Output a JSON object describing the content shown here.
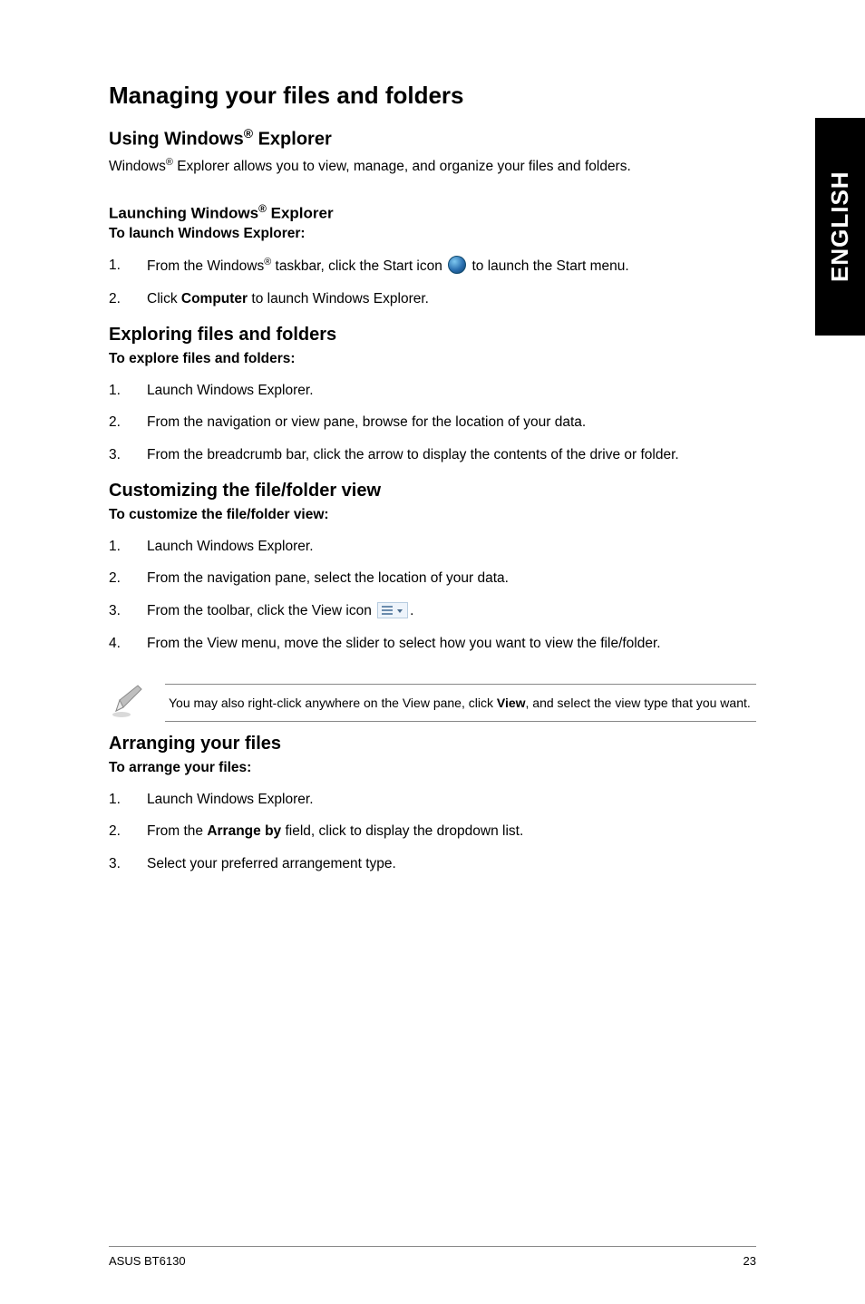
{
  "side_tab": "ENGLISH",
  "title": "Managing your files and folders",
  "s1": {
    "heading_pre": "Using Windows",
    "heading_sup": "®",
    "heading_post": " Explorer",
    "body_pre": "Windows",
    "body_sup": "®",
    "body_post": " Explorer allows you to view, manage, and organize your files and folders."
  },
  "s1a": {
    "heading_pre": "Launching Windows",
    "heading_sup": "®",
    "heading_post": " Explorer",
    "label": "To launch Windows Explorer:",
    "items": [
      {
        "num": "1.",
        "pre": "From the Windows",
        "sup": "®",
        "mid": " taskbar, click the Start icon ",
        "post": " to launch the Start menu."
      },
      {
        "num": "2.",
        "pre": "Click ",
        "bold": "Computer",
        "post": " to launch Windows Explorer."
      }
    ]
  },
  "s2": {
    "heading": "Exploring files and folders",
    "label": "To explore files and folders:",
    "items": [
      {
        "num": "1.",
        "text": "Launch Windows Explorer."
      },
      {
        "num": "2.",
        "text": "From the navigation or view pane, browse for the location of your data."
      },
      {
        "num": "3.",
        "text": "From the breadcrumb bar, click the arrow to display the contents of the drive or folder."
      }
    ]
  },
  "s3": {
    "heading": "Customizing the file/folder view",
    "label": "To customize the file/folder view:",
    "items": [
      {
        "num": "1.",
        "text": "Launch Windows Explorer."
      },
      {
        "num": "2.",
        "text": "From the navigation pane, select the location of your data."
      },
      {
        "num": "3.",
        "pre": "From the toolbar, click the View icon ",
        "post": "."
      },
      {
        "num": "4.",
        "text": "From the View menu, move the slider to select how you want to view the file/folder."
      }
    ],
    "note_pre": "You may also right-click anywhere on the View pane, click ",
    "note_bold": "View",
    "note_post": ", and select the view type that you want."
  },
  "s4": {
    "heading": "Arranging your files",
    "label": "To arrange your files:",
    "items": [
      {
        "num": "1.",
        "text": "Launch Windows Explorer."
      },
      {
        "num": "2.",
        "pre": "From the ",
        "bold": "Arrange by",
        "post": " field, click to display the dropdown list."
      },
      {
        "num": "3.",
        "text": "Select your preferred arrangement type."
      }
    ]
  },
  "footer": {
    "left": "ASUS BT6130",
    "right": "23"
  }
}
